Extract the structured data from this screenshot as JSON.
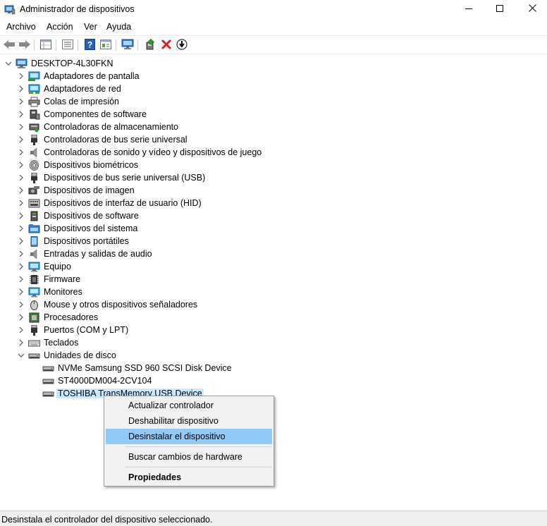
{
  "window": {
    "title": "Administrador de dispositivos",
    "controls": [
      "minimize-icon",
      "maximize-icon",
      "close-icon"
    ]
  },
  "menubar": {
    "items": [
      "Archivo",
      "Acción",
      "Ver",
      "Ayuda"
    ]
  },
  "toolbar": {
    "buttons": [
      "back-arrow-icon",
      "forward-arrow-icon",
      "properties-grid-icon",
      "view-list-icon",
      "help-icon",
      "console-tree-icon",
      "scan-monitor-icon",
      "update-driver-icon",
      "uninstall-x-icon",
      "disable-download-icon"
    ]
  },
  "tree": {
    "root": "DESKTOP-4L30FKN",
    "categories": [
      {
        "label": "Adaptadores de pantalla",
        "icon": "display-adapter-icon"
      },
      {
        "label": "Adaptadores de red",
        "icon": "network-adapter-icon"
      },
      {
        "label": "Colas de impresión",
        "icon": "printer-icon"
      },
      {
        "label": "Componentes de software",
        "icon": "software-component-icon"
      },
      {
        "label": "Controladoras de almacenamiento",
        "icon": "storage-controller-icon"
      },
      {
        "label": "Controladoras de bus serie universal",
        "icon": "usb-plug-icon"
      },
      {
        "label": "Controladoras de sonido y vídeo y dispositivos de juego",
        "icon": "speaker-icon"
      },
      {
        "label": "Dispositivos biométricos",
        "icon": "fingerprint-icon"
      },
      {
        "label": "Dispositivos de bus serie universal (USB)",
        "icon": "usb-plug-icon"
      },
      {
        "label": "Dispositivos de imagen",
        "icon": "camera-icon"
      },
      {
        "label": "Dispositivos de interfaz de usuario (HID)",
        "icon": "hid-keyboard-icon"
      },
      {
        "label": "Dispositivos de software",
        "icon": "software-device-icon"
      },
      {
        "label": "Dispositivos del sistema",
        "icon": "system-folder-icon"
      },
      {
        "label": "Dispositivos portátiles",
        "icon": "portable-device-icon"
      },
      {
        "label": "Entradas y salidas de audio",
        "icon": "speaker-icon"
      },
      {
        "label": "Equipo",
        "icon": "monitor-icon"
      },
      {
        "label": "Firmware",
        "icon": "chip-icon"
      },
      {
        "label": "Monitores",
        "icon": "monitor-icon"
      },
      {
        "label": "Mouse y otros dispositivos señaladores",
        "icon": "mouse-icon"
      },
      {
        "label": "Procesadores",
        "icon": "processor-icon"
      },
      {
        "label": "Puertos (COM y LPT)",
        "icon": "port-icon"
      },
      {
        "label": "Teclados",
        "icon": "keyboard-icon"
      },
      {
        "label": "Unidades de disco",
        "icon": "disk-drive-icon",
        "expanded": true
      }
    ],
    "disk_children": [
      {
        "label": "NVMe Samsung SSD 960 SCSI Disk Device",
        "icon": "disk-drive-icon"
      },
      {
        "label": "ST4000DM004-2CV104",
        "icon": "disk-drive-icon"
      },
      {
        "label": "TOSHIBA TransMemory USB Device",
        "icon": "disk-drive-icon",
        "selected": true
      }
    ]
  },
  "context_menu": {
    "items": [
      {
        "label": "Actualizar controlador"
      },
      {
        "label": "Deshabilitar dispositivo"
      },
      {
        "label": "Desinstalar el dispositivo",
        "highlighted": true
      },
      {
        "label": "Buscar cambios de hardware"
      },
      {
        "label": "Propiedades",
        "bold": true
      }
    ]
  },
  "statusbar": {
    "text": "Desinstala el controlador del dispositivo seleccionado."
  },
  "colors": {
    "selection": "#cce8ff",
    "menu_highlight": "#91c9f7",
    "uninstall_red": "#d81e1e",
    "update_green": "#2c9a2c",
    "help_blue": "#2b5fb0"
  }
}
